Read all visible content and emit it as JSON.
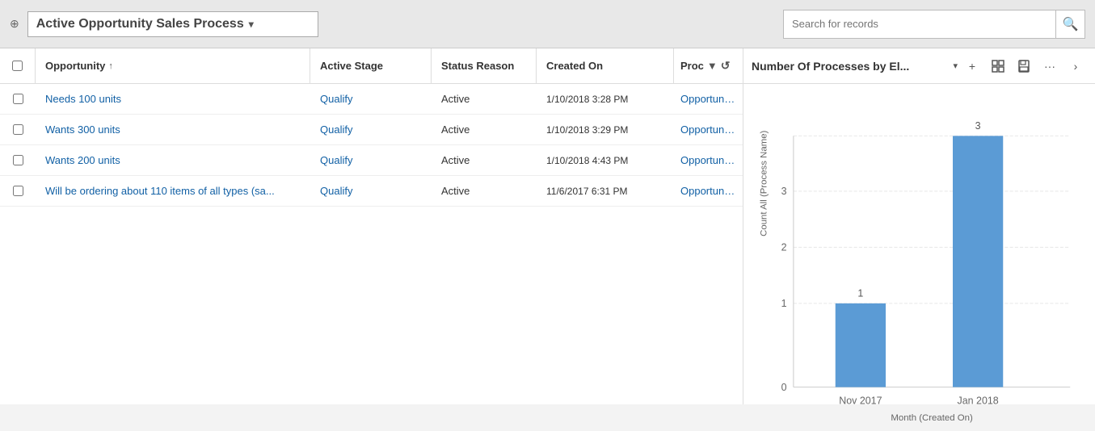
{
  "header": {
    "title": "Active Opportunity Sales Process",
    "dropdown_arrow": "▾",
    "search_placeholder": "Search for records"
  },
  "table": {
    "columns": [
      {
        "key": "opportunity",
        "label": "Opportunity",
        "sort": "↑"
      },
      {
        "key": "active_stage",
        "label": "Active Stage"
      },
      {
        "key": "status_reason",
        "label": "Status Reason"
      },
      {
        "key": "created_on",
        "label": "Created On"
      },
      {
        "key": "process",
        "label": "Proc"
      }
    ],
    "rows": [
      {
        "opportunity": "Needs 100 units",
        "active_stage": "Qualify",
        "status_reason": "Active",
        "created_on": "1/10/2018 3:28 PM",
        "process": "Opportunity Sa..."
      },
      {
        "opportunity": "Wants 300 units",
        "active_stage": "Qualify",
        "status_reason": "Active",
        "created_on": "1/10/2018 3:29 PM",
        "process": "Opportunity Sa..."
      },
      {
        "opportunity": "Wants 200 units",
        "active_stage": "Qualify",
        "status_reason": "Active",
        "created_on": "1/10/2018 4:43 PM",
        "process": "Opportunity Sa..."
      },
      {
        "opportunity": "Will be ordering about 110 items of all types (sa...",
        "active_stage": "Qualify",
        "status_reason": "Active",
        "created_on": "11/6/2017 6:31 PM",
        "process": "Opportunity Sa..."
      }
    ]
  },
  "chart": {
    "title": "Number Of Processes by El...",
    "y_axis_label": "Count All (Process Name)",
    "x_axis_label": "Month (Created On)",
    "bars": [
      {
        "month": "Nov 2017",
        "value": 1
      },
      {
        "month": "Jan 2018",
        "value": 3
      }
    ],
    "y_max": 3,
    "y_ticks": [
      0,
      1,
      2,
      3
    ],
    "bar_color": "#5b9bd5",
    "bar_label_1": "1",
    "bar_label_2": "3"
  },
  "icons": {
    "pin": "⊕",
    "search": "🔍",
    "filter": "▼",
    "refresh": "↺",
    "add": "+",
    "chart_type": "⊞",
    "save": "💾",
    "more": "...",
    "expand": "›"
  }
}
